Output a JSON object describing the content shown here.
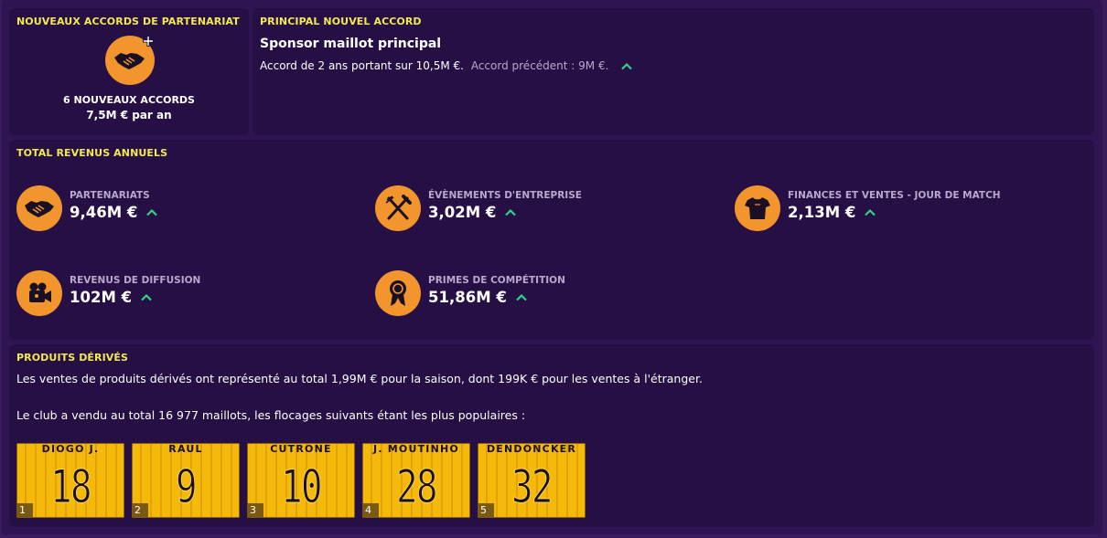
{
  "partnerships": {
    "title": "NOUVEAUX ACCORDS DE PARTENARIAT",
    "count_text": "6 NOUVEAUX ACCORDS",
    "amount_text": "7,5M € par an",
    "icon": "handshake-plus-icon"
  },
  "main_deal": {
    "title": "PRINCIPAL NOUVEL ACCORD",
    "heading": "Sponsor maillot principal",
    "detail": "Accord de 2 ans portant sur 10,5M €.",
    "previous": "Accord précédent : 9M €.",
    "trend": "up"
  },
  "revenue": {
    "title": "TOTAL REVENUS ANNUELS",
    "items": [
      {
        "label": "PARTENARIATS",
        "value": "9,46M €",
        "icon": "handshake-icon",
        "trend": "up"
      },
      {
        "label": "ÉVÈNEMENTS D'ENTREPRISE",
        "value": "3,02M €",
        "icon": "fork-knife-icon",
        "trend": "up"
      },
      {
        "label": "FINANCES ET VENTES - JOUR DE MATCH",
        "value": "2,13M €",
        "icon": "shirt-icon",
        "trend": "up"
      },
      {
        "label": "REVENUS DE DIFFUSION",
        "value": "102M €",
        "icon": "camera-icon",
        "trend": "up"
      },
      {
        "label": "PRIMES DE COMPÉTITION",
        "value": "51,86M €",
        "icon": "medal-icon",
        "trend": "up"
      }
    ]
  },
  "merch": {
    "title": "PRODUITS DÉRIVÉS",
    "sales_text": "Les ventes de produits dérivés ont représenté au total 1,99M € pour la saison, dont 199K € pour les ventes à l'étranger.",
    "shirts_text": "Le club a vendu au total 16 977 maillots, les flocages suivants étant les plus populaires :",
    "jerseys": [
      {
        "name": "DIOGO J.",
        "number": "18",
        "rank": "1"
      },
      {
        "name": "RAUL",
        "number": "9",
        "rank": "2"
      },
      {
        "name": "CUTRONE",
        "number": "10",
        "rank": "3"
      },
      {
        "name": "J. MOUTINHO",
        "number": "28",
        "rank": "4"
      },
      {
        "name": "DENDONCKER",
        "number": "32",
        "rank": "5"
      }
    ]
  },
  "colors": {
    "accent_yellow": "#f2e94e",
    "icon_orange": "#f3952d",
    "trend_green": "#2fd38a",
    "panel_bg": "#260f45"
  }
}
